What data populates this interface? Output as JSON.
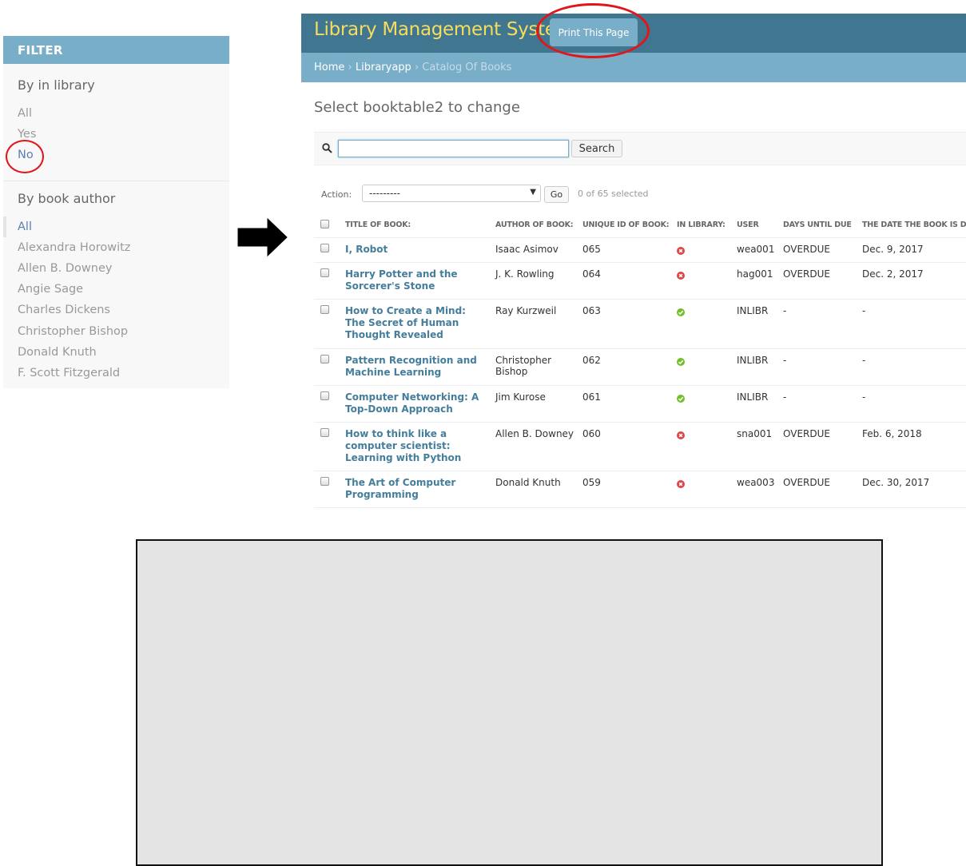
{
  "filter": {
    "header": "FILTER",
    "library_section": {
      "title": "By in library",
      "items": [
        "All",
        "Yes",
        "No"
      ]
    },
    "author_section": {
      "title": "By book author",
      "items": [
        "All",
        "Alexandra Horowitz",
        "Allen B. Downey",
        "Angie Sage",
        "Charles Dickens",
        "Christopher Bishop",
        "Donald Knuth",
        "F. Scott Fitzgerald"
      ]
    }
  },
  "header": {
    "site_title": "Library Management System",
    "print_button": "Print This Page"
  },
  "breadcrumbs": {
    "home": "Home",
    "app": "Libraryapp",
    "current": "Catalog Of Books",
    "separator": "›"
  },
  "page_title": "Select booktable2 to change",
  "search": {
    "value": "",
    "button": "Search"
  },
  "actions": {
    "label": "Action:",
    "selected_option": "---------",
    "go_button": "Go",
    "selected_count": "0 of 65 selected"
  },
  "table": {
    "columns": [
      "TITLE OF BOOK:",
      "AUTHOR OF BOOK:",
      "UNIQUE ID OF BOOK:",
      "IN LIBRARY:",
      "USER",
      "DAYS UNTIL DUE",
      "THE DATE THE BOOK IS DUE"
    ],
    "rows": [
      {
        "title": "I, Robot",
        "author": "Isaac Asimov",
        "id": "065",
        "in_library": false,
        "user": "wea001",
        "days": "OVERDUE",
        "due": "Dec. 9, 2017"
      },
      {
        "title": "Harry Potter and the Sorcerer's Stone",
        "author": "J. K. Rowling",
        "id": "064",
        "in_library": false,
        "user": "hag001",
        "days": "OVERDUE",
        "due": "Dec. 2, 2017"
      },
      {
        "title": "How to Create a Mind: The Secret of Human Thought Revealed",
        "author": "Ray Kurzweil",
        "id": "063",
        "in_library": true,
        "user": "INLIBR",
        "days": "-",
        "due": "-"
      },
      {
        "title": "Pattern Recognition and Machine Learning",
        "author": "Christopher Bishop",
        "id": "062",
        "in_library": true,
        "user": "INLIBR",
        "days": "-",
        "due": "-"
      },
      {
        "title": "Computer Networking: A Top-Down Approach",
        "author": "Jim Kurose",
        "id": "061",
        "in_library": true,
        "user": "INLIBR",
        "days": "-",
        "due": "-"
      },
      {
        "title": "How to think like a computer scientist: Learning with Python",
        "author": "Allen B. Downey",
        "id": "060",
        "in_library": false,
        "user": "sna001",
        "days": "OVERDUE",
        "due": "Feb. 6, 2018"
      },
      {
        "title": "The Art of Computer Programming",
        "author": "Donald Knuth",
        "id": "059",
        "in_library": false,
        "user": "wea003",
        "days": "OVERDUE",
        "due": "Dec. 30, 2017"
      }
    ]
  },
  "colors": {
    "header_bg": "#417690",
    "breadcrumb_bg": "#79aec8",
    "site_title": "#f5dd5d",
    "link": "#447e9b",
    "highlight_circle": "#e0161b",
    "status_no": "#dd4646",
    "status_yes": "#70bf2b"
  }
}
